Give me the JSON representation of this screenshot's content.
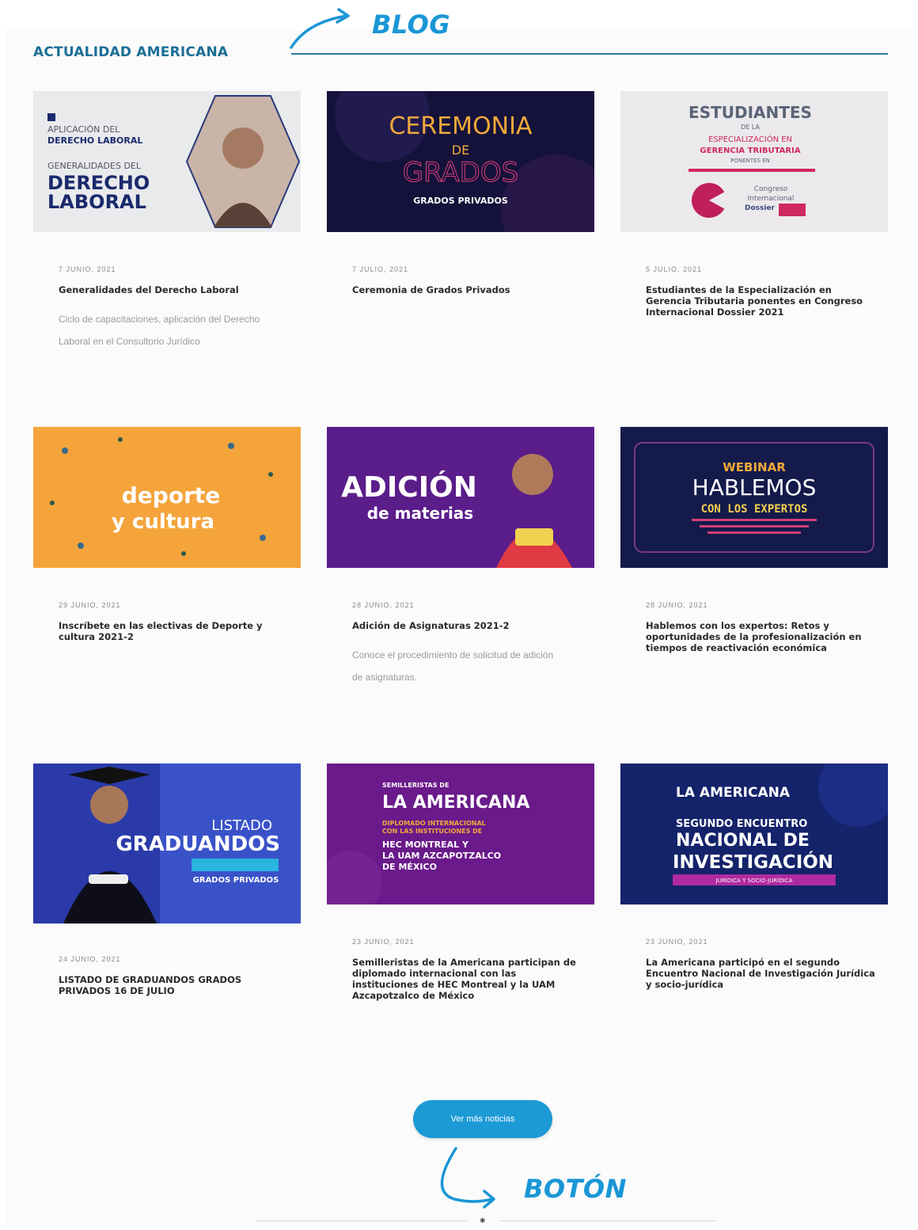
{
  "annotations": {
    "blog": "BLOG",
    "boton": "BOTÓN"
  },
  "section": {
    "title": "ACTUALIDAD AMERICANA"
  },
  "colors": {
    "accent": "#1c9ad6",
    "section_title": "#1b6f97"
  },
  "cards": [
    {
      "date": "7 junio, 2021",
      "title": "Generalidades del Derecho Laboral",
      "excerpt": "Ciclo de capacitaciones, aplicación del Derecho Laboral en el Consultorio Jurídico",
      "image": {
        "l1": "APLICACIÓN DEL",
        "l2": "DERECHO LABORAL",
        "l3": "GENERALIDADES DEL",
        "l4": "DERECHO",
        "l5": "LABORAL"
      }
    },
    {
      "date": "7 julio, 2021",
      "title": "Ceremonia de Grados Privados",
      "excerpt": "",
      "image": {
        "l1": "CEREMONIA",
        "l2": "DE",
        "l3": "GRADOS",
        "l4": "GRADOS PRIVADOS"
      }
    },
    {
      "date": "5 julio, 2021",
      "title": "Estudiantes de la Especialización en Gerencia Tributaria ponentes en Congreso Internacional Dossier 2021",
      "excerpt": "",
      "image": {
        "l1": "ESTUDIANTES",
        "l2": "DE LA",
        "l3": "ESPECIALIZACIÓN EN",
        "l4": "GERENCIA TRIBUTARIA",
        "l5": "PONENTES EN",
        "l6": "Congreso",
        "l7": "Internacional",
        "l8": "Dossier"
      }
    },
    {
      "date": "29 junio, 2021",
      "title": "Inscríbete en las electivas de Deporte y cultura 2021-2",
      "excerpt": "",
      "image": {
        "l1": "deporte",
        "l2": "y cultura"
      }
    },
    {
      "date": "28 junio, 2021",
      "title": "Adición de Asignaturas 2021-2",
      "excerpt": "Conoce el procedimiento de solicitud de adición de asignaturas.",
      "image": {
        "l1": "ADICIÓN",
        "l2": "de materias"
      }
    },
    {
      "date": "28 junio, 2021",
      "title": "Hablemos con los expertos: Retos y oportunidades de la profesionalización en tiempos de reactivación económica",
      "excerpt": "",
      "image": {
        "l1": "WEBINAR",
        "l2": "HABLEMOS",
        "l3": "CON LOS EXPERTOS"
      }
    },
    {
      "date": "24 junio, 2021",
      "title": "LISTADO DE GRADUANDOS GRADOS PRIVADOS 16 DE JULIO",
      "excerpt": "",
      "image": {
        "l1": "LISTADO",
        "l2": "GRADUANDOS",
        "l3": "GRADOS PRIVADOS"
      }
    },
    {
      "date": "23 junio, 2021",
      "title": "Semilleristas de la Americana participan de diplomado internacional con las instituciones de HEC Montreal y la UAM Azcapotzalco de México",
      "excerpt": "",
      "image": {
        "l1": "SEMILLERISTAS DE",
        "l2": "LA AMERICANA",
        "l3": "DIPLOMADO INTERNACIONAL",
        "l4": "CON LAS INSTITUCIONES DE",
        "l5": "HEC MONTREAL Y",
        "l6": "LA UAM AZCAPOTZALCO",
        "l7": "DE MÉXICO"
      }
    },
    {
      "date": "23 junio, 2021",
      "title": "La Americana participó en el segundo Encuentro Nacional de Investigación Jurídica y socio-jurídica",
      "excerpt": "",
      "image": {
        "l1": "LA AMERICANA",
        "l2": "SEGUNDO ENCUENTRO",
        "l3": "NACIONAL DE",
        "l4": "INVESTIGACIÓN",
        "l5": "JURÍDICA Y SOCIO-JURÍDICA"
      }
    }
  ],
  "more_button": {
    "label": "Ver más noticias"
  }
}
